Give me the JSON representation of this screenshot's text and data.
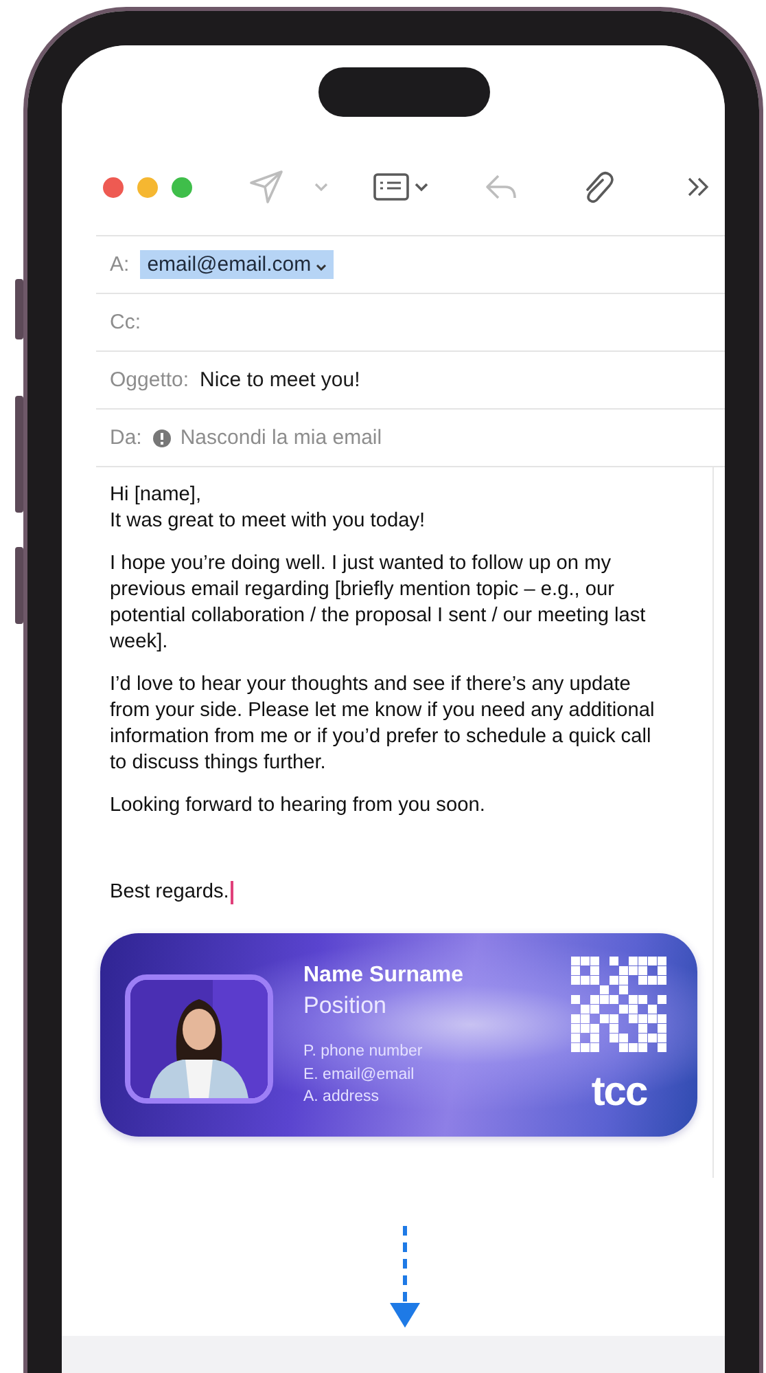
{
  "toolbar": {
    "window_controls": [
      {
        "color": "#ee5a52"
      },
      {
        "color": "#f5b731"
      },
      {
        "color": "#3fbe4a"
      }
    ],
    "buttons": [
      {
        "kind": "send",
        "disabled": true
      },
      {
        "kind": "caret",
        "disabled": true
      },
      {
        "kind": "format",
        "disabled": false
      },
      {
        "kind": "reply",
        "disabled": true
      },
      {
        "kind": "attach",
        "disabled": false
      },
      {
        "kind": "more",
        "disabled": false
      }
    ]
  },
  "fields": [
    {
      "kind": "recipient",
      "label": "A:",
      "value": "email@email.com",
      "selected": true
    },
    {
      "kind": "plain",
      "label": "Cc:"
    },
    {
      "kind": "subject",
      "label": "Oggetto:",
      "value": "Nice to meet you!"
    },
    {
      "kind": "sender",
      "label": "Da:",
      "value": "Nascondi la mia email"
    }
  ],
  "body": {
    "paragraphs": [
      "Hi [name],\nIt was great to meet with you today!",
      "I hope you’re doing well. I just wanted to follow up on my previous email regarding [briefly mention topic – e.g., our potential collaboration / the proposal I sent / our meeting last week].",
      "I’d love to hear your thoughts and see if there’s any update from your side. Please let me know if you need any additional information from me or if you’d prefer to schedule a quick call to discuss things further.",
      "Looking forward to hearing from you soon."
    ],
    "closing": "Best regards."
  },
  "signature": {
    "photo": {
      "kind": "picture"
    },
    "name": "Name Surname",
    "position": "Position",
    "contacts": [
      "P. phone number",
      "E. email@email",
      "A. address"
    ],
    "logo": "tcc"
  }
}
